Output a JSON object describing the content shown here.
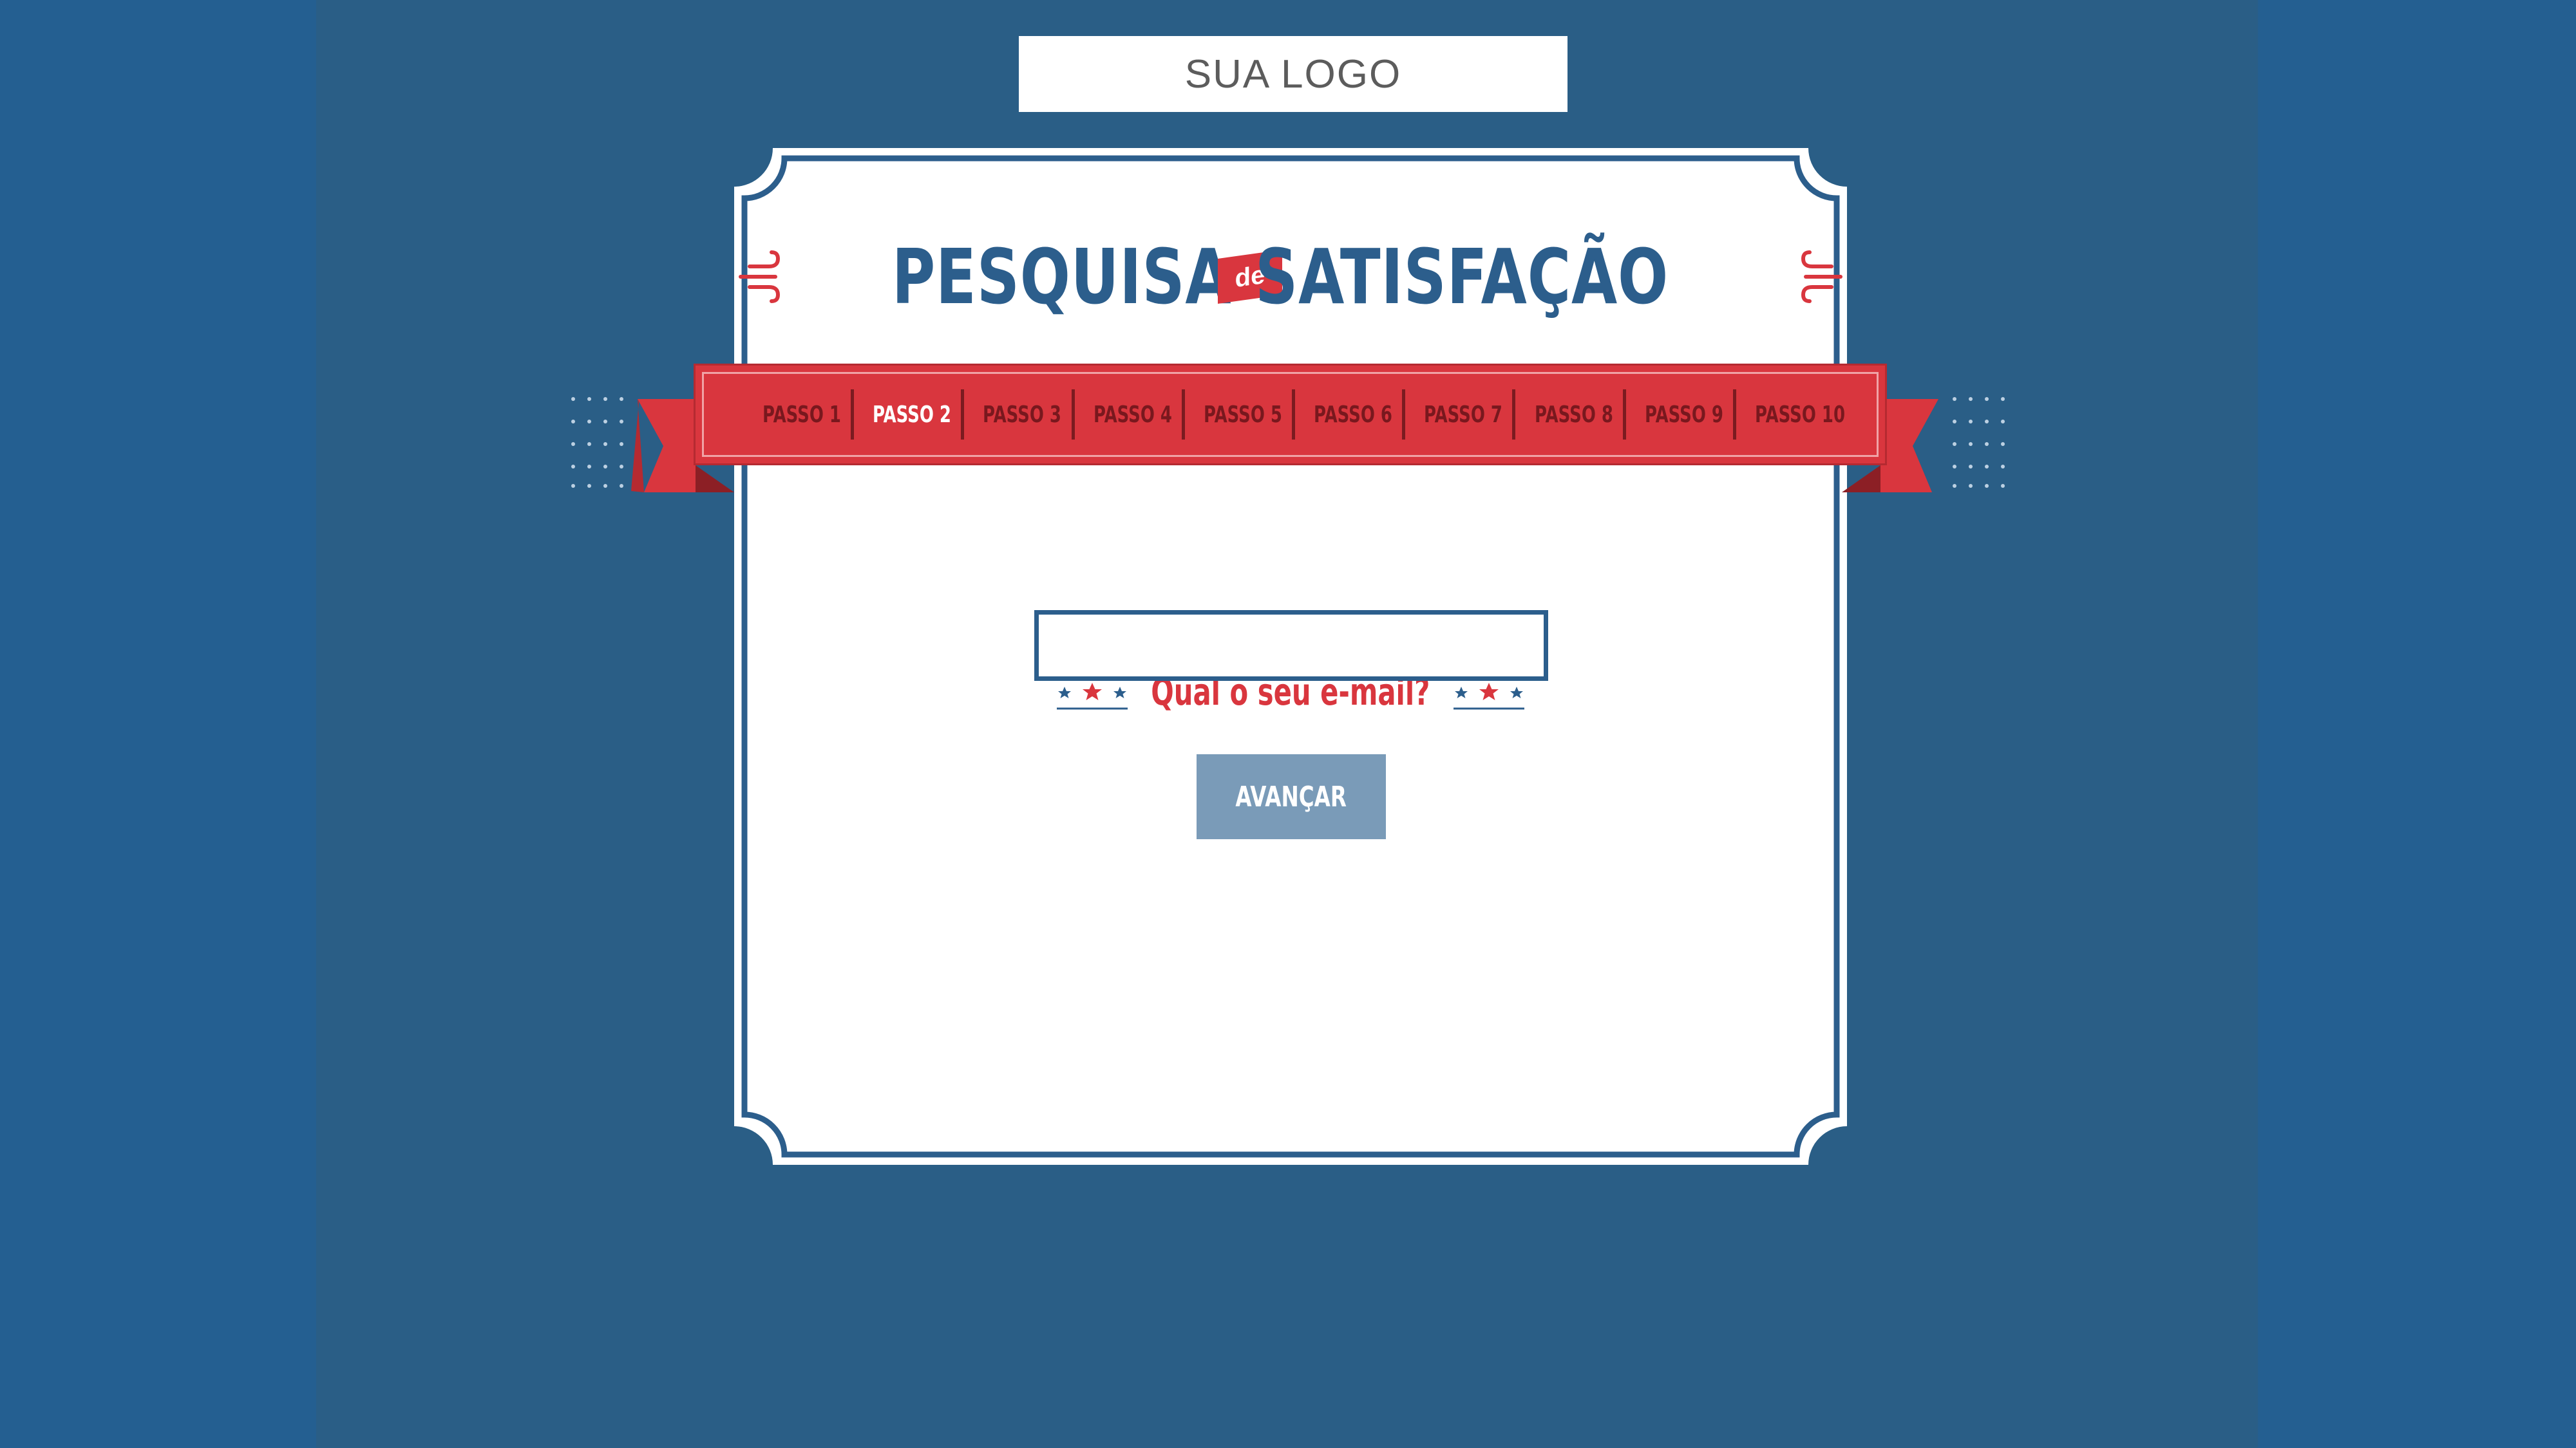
{
  "logo": {
    "text": "SUA LOGO"
  },
  "title": {
    "left_word": "PESQUISA",
    "badge": "de",
    "right_word": "SATISFAÇÃO"
  },
  "steps": {
    "items": [
      "PASSO 1",
      "PASSO 2",
      "PASSO 3",
      "PASSO 4",
      "PASSO 5",
      "PASSO 6",
      "PASSO 7",
      "PASSO 8",
      "PASSO 9",
      "PASSO 10"
    ],
    "active_index": 1
  },
  "form": {
    "question": "Qual o seu e-mail?",
    "email_value": "",
    "submit_label": "AVANÇAR"
  },
  "colors": {
    "background": "#245f91",
    "primary_blue": "#2c5e8c",
    "ribbon_red": "#d9363e",
    "button": "#7a9bb8",
    "card": "#ffffff"
  }
}
